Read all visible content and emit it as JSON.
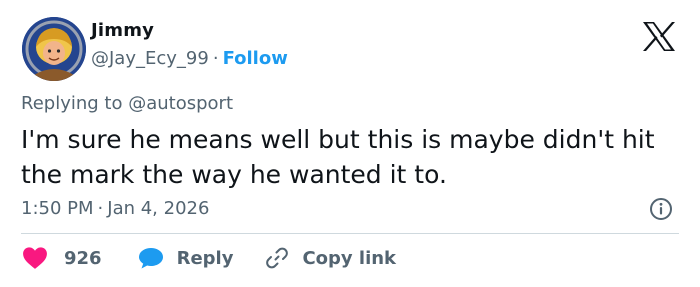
{
  "author": {
    "name": "Jimmy",
    "handle": "@Jay_Ecy_99",
    "separator": "·",
    "follow_label": "Follow",
    "avatar_icon": "cartoon-character-avatar"
  },
  "platform_icon": "x-logo-icon",
  "reply_context": {
    "prefix": "Replying to",
    "mention": "@autosport"
  },
  "tweet": {
    "text": "I'm sure he means well but this is maybe didn't hit the mark the way he wanted it to."
  },
  "meta": {
    "time": "1:50 PM",
    "separator": "·",
    "date": "Jan 4, 2026"
  },
  "actions": {
    "like_count": "926",
    "reply_label": "Reply",
    "copy_link_label": "Copy link"
  },
  "colors": {
    "accent": "#1d9bf0",
    "like": "#f91880",
    "secondary_text": "#536471",
    "primary_text": "#0f1419",
    "divider": "#cfd9de"
  }
}
